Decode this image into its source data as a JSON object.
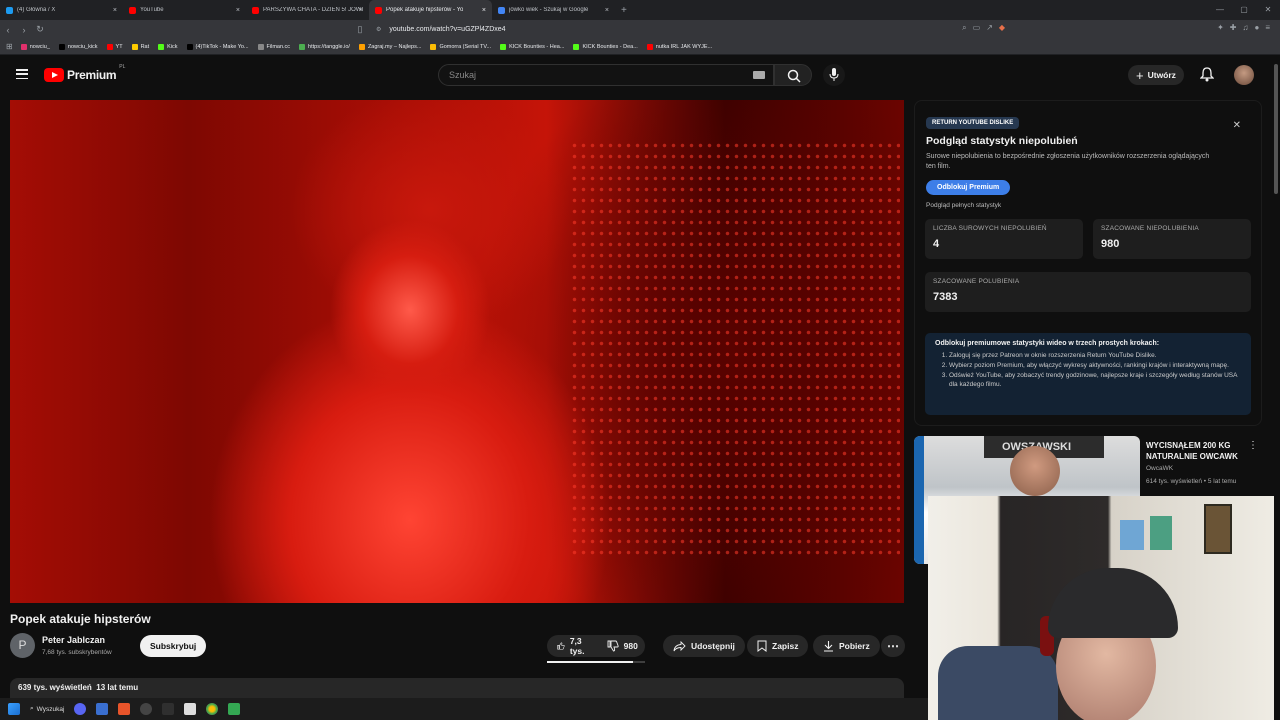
{
  "browser": {
    "tabs": [
      {
        "label": "(4) Główna / X",
        "color": "#1d9bf0",
        "active": false
      },
      {
        "label": "YouTube",
        "color": "#ff0000",
        "active": false
      },
      {
        "label": "PARSZYWA CHATA - DZIEŃ 5! JÓWI...",
        "color": "#ff0000",
        "active": false
      },
      {
        "label": "Popek atakuje hipsterów - Yo",
        "color": "#ff0000",
        "active": true
      },
      {
        "label": "jówko wiek - Szukaj w Google",
        "color": "#4285f4",
        "active": false
      }
    ],
    "url": "youtube.com/watch?v=uGZPl4ZDxe4",
    "bookmarks": [
      {
        "label": "nowciu_",
        "color": "#e1306c"
      },
      {
        "label": "nowciu_kick",
        "color": "#000000"
      },
      {
        "label": "YT",
        "color": "#ff0000"
      },
      {
        "label": "Rat",
        "color": "#ffcc00"
      },
      {
        "label": "Kick",
        "color": "#53fc18"
      },
      {
        "label": "(4)TikTok - Make Yo...",
        "color": "#000000"
      },
      {
        "label": "Filman.cc",
        "color": "#888888"
      },
      {
        "label": "https://tanggle.io/",
        "color": "#4caf50"
      },
      {
        "label": "Zagraj.my – Najleps...",
        "color": "#ffa000"
      },
      {
        "label": "Gomorra (Serial TV...",
        "color": "#fbbc05"
      },
      {
        "label": "KICK Bounties - Hea...",
        "color": "#53fc18"
      },
      {
        "label": "KICK Bounties - Dea...",
        "color": "#53fc18"
      },
      {
        "label": "nutka IRL JAK WYJE...",
        "color": "#ff0000"
      }
    ]
  },
  "header": {
    "logo_text": "Premium",
    "country": "PL",
    "search_placeholder": "Szukaj",
    "create_label": "Utwórz"
  },
  "video": {
    "title": "Popek atakuje hipsterów",
    "channel": "Peter Jablczan",
    "channel_initial": "P",
    "subscribers": "7,68 tys. subskrybentów",
    "subscribe_label": "Subskrybuj",
    "likes": "7,3 tys.",
    "dislikes": "980",
    "like_ratio": 0.88,
    "share_label": "Udostępnij",
    "save_label": "Zapisz",
    "download_label": "Pobierz",
    "views": "639 tys. wyświetleń",
    "age": "13 lat temu"
  },
  "ryd_panel": {
    "badge": "RETURN YOUTUBE DISLIKE",
    "title": "Podgląd statystyk niepolubień",
    "subtitle": "Surowe niepolubienia to bezpośrednie zgłoszenia użytkowników rozszerzenia oglądających ten film.",
    "unlock_label": "Odblokuj Premium",
    "preview_label": "Podgląd pełnych statystyk",
    "stats": {
      "raw_label": "LICZBA SUROWYCH NIEPOLUBIEŃ",
      "raw_value": "4",
      "est_dislikes_label": "SZACOWANE NIEPOLUBIENIA",
      "est_dislikes_value": "980",
      "est_likes_label": "SZACOWANE POLUBIENIA",
      "est_likes_value": "7383"
    },
    "steps_header": "Odblokuj premiumowe statystyki wideo w trzech prostych krokach:",
    "steps": [
      "Zaloguj się przez Patreon w oknie rozszerzenia Return YouTube Dislike.",
      "Wybierz poziom Premium, aby włączyć wykresy aktywności, rankingi krajów i interaktywną mapę.",
      "Odśwież YouTube, aby zobaczyć trendy godzinowe, najlepsze kraje i szczegóły według stanów USA dla każdego filmu."
    ]
  },
  "recommendation": {
    "title": "WYCISNĄŁEM 200 KG NATURALNIE OWCAWK",
    "channel": "OwcaWK",
    "meta": "614 tys. wyświetleń • 5 lat temu",
    "thumb_sign": "OWSZAWSKI"
  },
  "taskbar": {
    "search_label": "Wyszukaj"
  }
}
